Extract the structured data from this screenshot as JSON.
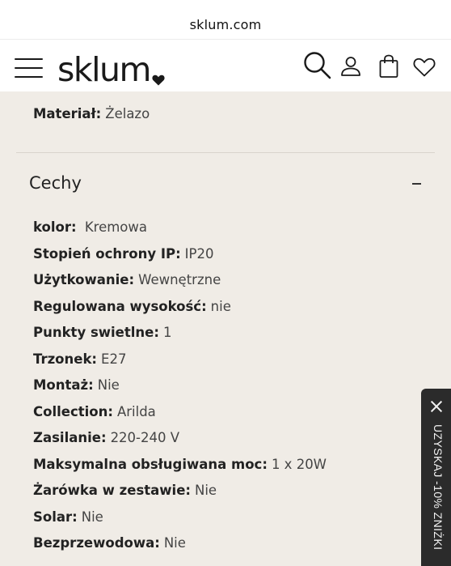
{
  "browser": {
    "url": "sklum.com"
  },
  "header": {
    "logo_text": "sklum"
  },
  "top_spec": {
    "label": "Materiał:",
    "value": "Żelazo"
  },
  "section": {
    "title": "Cechy",
    "toggle_symbol": "–",
    "rows": [
      {
        "label": "kolor:",
        "value": " Kremowa"
      },
      {
        "label": "Stopień ochrony IP:",
        "value": "IP20"
      },
      {
        "label": "Użytkowanie:",
        "value": "Wewnętrzne"
      },
      {
        "label": "Regulowana wysokość:",
        "value": "nie"
      },
      {
        "label": "Punkty swietlne:",
        "value": "1"
      },
      {
        "label": "Trzonek:",
        "value": "E27"
      },
      {
        "label": "Montaż:",
        "value": "Nie"
      },
      {
        "label": "Collection:",
        "value": "Arilda"
      },
      {
        "label": "Zasilanie:",
        "value": "220-240 V"
      },
      {
        "label": "Maksymalna obsługiwana moc:",
        "value": "1 x 20W"
      },
      {
        "label": "Żarówka w zestawie:",
        "value": "Nie"
      },
      {
        "label": "Solar:",
        "value": "Nie"
      },
      {
        "label": "Bezprzewodowa:",
        "value": "Nie"
      }
    ]
  },
  "promo": {
    "label": "UZYSKAJ -10% ZNIŻKI"
  },
  "colors": {
    "background": "#f0ece6",
    "header": "#ffffff",
    "promo_bg": "#2b2b2b"
  }
}
